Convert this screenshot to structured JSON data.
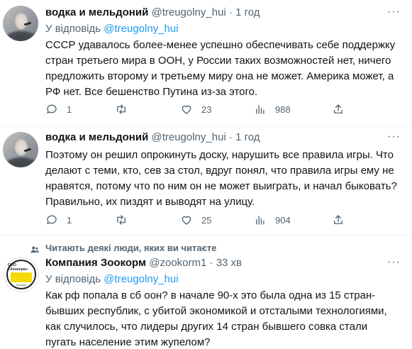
{
  "tweets": [
    {
      "name": "водка и мельдоний",
      "handle": "@treugolny_hui",
      "sep": "·",
      "time": "1 год",
      "reply_prefix": "У відповідь",
      "reply_handle": "@treugolny_hui",
      "text": "СССР удавалось более-менее успешно обеспечивать себе поддержку стран третьего мира в ООН, у России таких возможностей нет, ничего предложить второму и третьему миру она не может. Америка может, а РФ нет. Все бешенство Путина из-за этого.",
      "replies": "1",
      "retweets": "",
      "likes": "23",
      "views": "988"
    },
    {
      "name": "водка и мельдоний",
      "handle": "@treugolny_hui",
      "sep": "·",
      "time": "1 год",
      "text": "Поэтому он решил опрокинуть доску, нарушить все правила игры. Что делают с теми, кто, сев за стол, вдруг понял, что правила игры ему не нравятся, потому что по ним он не может выиграть, и начал быковать? Правильно, их пиздят и выводят на улицу.",
      "replies": "1",
      "retweets": "",
      "likes": "25",
      "views": "904"
    },
    {
      "social_context": "Читають деякі люди, яких ви читаєте",
      "name": "Компания Зоокорм",
      "handle": "@zookorm1",
      "sep": "·",
      "time": "33 хв",
      "reply_prefix": "У відповідь",
      "reply_handle": "@treugolny_hui",
      "logo_top": "ООО «Зоокорм»",
      "logo_bottom": "zookorm",
      "text": "Как рф попала в сб оон? в начале 90-х это была одна из 15 стран-бывших республик, с убитой экономикой и отсталыми технологиями, как случилось, что лидеры других 14 стран бывшего совка стали пугать население этим жупелом?"
    }
  ],
  "more_label": "···",
  "icons": {
    "reply": "reply-icon",
    "retweet": "retweet-icon",
    "like": "heart-icon",
    "views": "views-icon",
    "share": "share-icon",
    "social": "people-icon"
  },
  "colors": {
    "link": "#1d9bf0",
    "muted": "#536471",
    "text": "#0f1419"
  }
}
